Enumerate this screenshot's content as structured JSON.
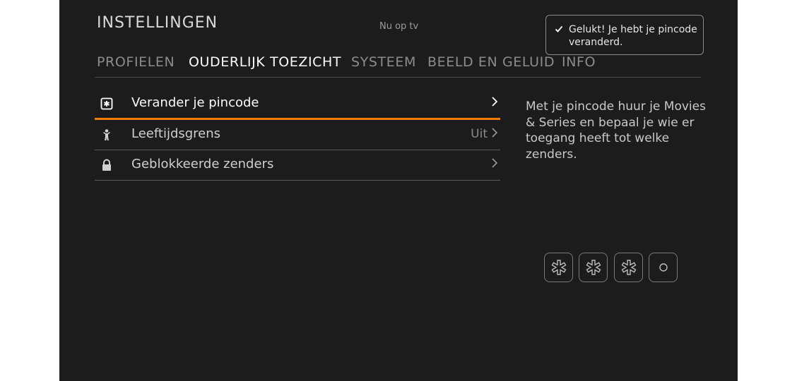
{
  "header": {
    "title": "INSTELLINGEN",
    "now_on_tv": "Nu op tv"
  },
  "toast": {
    "icon": "check-icon",
    "message": "Gelukt! Je hebt je pincode veranderd."
  },
  "tabs": [
    {
      "label": "PROFIELEN",
      "active": false
    },
    {
      "label": "OUDERLIJK TOEZICHT",
      "active": true
    },
    {
      "label": "SYSTEEM",
      "active": false
    },
    {
      "label": "BEELD EN GELUID",
      "active": false
    },
    {
      "label": "INFO",
      "active": false
    }
  ],
  "menu": {
    "items": [
      {
        "icon": "pincode-asterisk-icon",
        "label": "Verander je pincode",
        "value": "",
        "active": true
      },
      {
        "icon": "child-figure-icon",
        "label": "Leeftijdsgrens",
        "value": "Uit",
        "active": false
      },
      {
        "icon": "lock-icon",
        "label": "Geblokkeerde zenders",
        "value": "",
        "active": false
      }
    ]
  },
  "description": "Met je pincode huur je Movies & Series en bepaal je wie er toegang heeft tot welke zenders.",
  "pin_entry": {
    "digits_total": 4,
    "digits_entered": 3
  },
  "colors": {
    "background": "#1c1c1c",
    "accent": "#f07d00",
    "text_active": "#ffffff",
    "text_inactive": "#8c8c8c"
  }
}
